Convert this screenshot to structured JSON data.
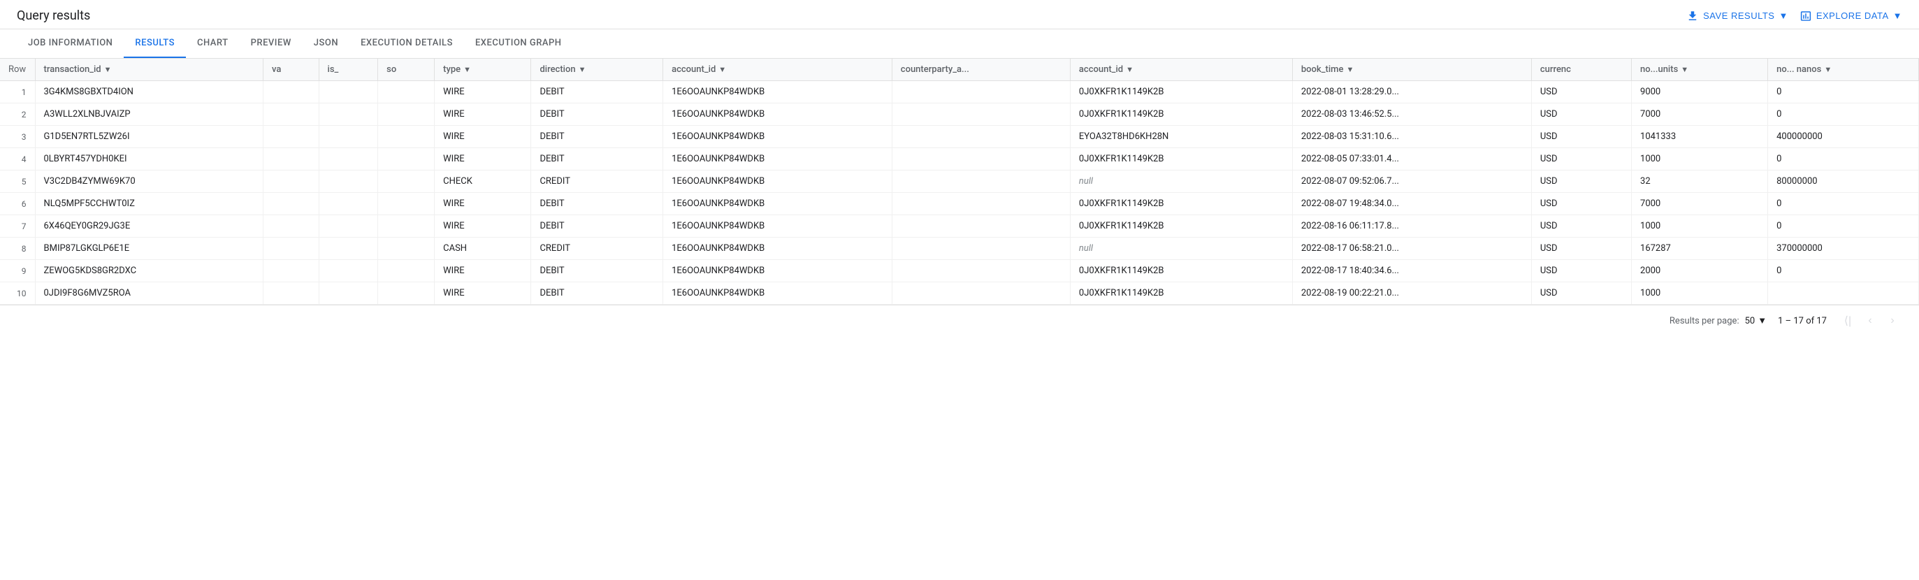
{
  "header": {
    "title": "Query results",
    "save_results_label": "SAVE RESULTS",
    "explore_data_label": "EXPLORE DATA"
  },
  "tabs": [
    {
      "id": "job-information",
      "label": "JOB INFORMATION",
      "active": false
    },
    {
      "id": "results",
      "label": "RESULTS",
      "active": true
    },
    {
      "id": "chart",
      "label": "CHART",
      "active": false
    },
    {
      "id": "preview-badge",
      "label": "PREVIEW",
      "badge": true
    },
    {
      "id": "json",
      "label": "JSON",
      "active": false
    },
    {
      "id": "execution-details",
      "label": "EXECUTION DETAILS",
      "active": false
    },
    {
      "id": "execution-graph",
      "label": "EXECUTION GRAPH",
      "active": false
    }
  ],
  "table": {
    "columns": [
      {
        "id": "row",
        "label": "Row"
      },
      {
        "id": "transaction_id",
        "label": "transaction_id",
        "sortable": true
      },
      {
        "id": "va",
        "label": "va",
        "sortable": false
      },
      {
        "id": "is",
        "label": "is_",
        "sortable": false
      },
      {
        "id": "so",
        "label": "so",
        "sortable": false
      },
      {
        "id": "type",
        "label": "type",
        "sortable": true
      },
      {
        "id": "direction",
        "label": "direction",
        "sortable": true
      },
      {
        "id": "account_id",
        "label": "account_id",
        "sortable": true
      },
      {
        "id": "counterparty_a",
        "label": "counterparty_a...",
        "sortable": false
      },
      {
        "id": "counterparty_account_id",
        "label": "account_id",
        "sortable": true
      },
      {
        "id": "book_time",
        "label": "book_time",
        "sortable": true
      },
      {
        "id": "currency",
        "label": "currenc",
        "sortable": false
      },
      {
        "id": "no_units",
        "label": "no...units",
        "sortable": true
      },
      {
        "id": "no_nanos",
        "label": "no... nanos",
        "sortable": true
      }
    ],
    "rows": [
      {
        "row": 1,
        "transaction_id": "3G4KMS8GBXTD4ION",
        "va": "",
        "is_": "",
        "so": "",
        "type": "WIRE",
        "direction": "DEBIT",
        "account_id": "1E6OOAUNKP84WDKB",
        "counterparty_a": "",
        "counterparty_account_id": "0J0XKFR1K1149K2B",
        "book_time": "2022-08-01 13:28:29.0...",
        "currency": "USD",
        "no_units": "9000",
        "no_nanos": "0"
      },
      {
        "row": 2,
        "transaction_id": "A3WLL2XLNBJVAIZP",
        "va": "",
        "is_": "",
        "so": "",
        "type": "WIRE",
        "direction": "DEBIT",
        "account_id": "1E6OOAUNKP84WDKB",
        "counterparty_a": "",
        "counterparty_account_id": "0J0XKFR1K1149K2B",
        "book_time": "2022-08-03 13:46:52.5...",
        "currency": "USD",
        "no_units": "7000",
        "no_nanos": "0"
      },
      {
        "row": 3,
        "transaction_id": "G1D5EN7RTL5ZW26I",
        "va": "",
        "is_": "",
        "so": "",
        "type": "WIRE",
        "direction": "DEBIT",
        "account_id": "1E6OOAUNKP84WDKB",
        "counterparty_a": "",
        "counterparty_account_id": "EYOA32T8HD6KH28N",
        "book_time": "2022-08-03 15:31:10.6...",
        "currency": "USD",
        "no_units": "1041333",
        "no_nanos": "400000000"
      },
      {
        "row": 4,
        "transaction_id": "0LBYRT457YDH0KEI",
        "va": "",
        "is_": "",
        "so": "",
        "type": "WIRE",
        "direction": "DEBIT",
        "account_id": "1E6OOAUNKP84WDKB",
        "counterparty_a": "",
        "counterparty_account_id": "0J0XKFR1K1149K2B",
        "book_time": "2022-08-05 07:33:01.4...",
        "currency": "USD",
        "no_units": "1000",
        "no_nanos": "0"
      },
      {
        "row": 5,
        "transaction_id": "V3C2DB4ZYMW69K70",
        "va": "",
        "is_": "",
        "so": "",
        "type": "CHECK",
        "direction": "CREDIT",
        "account_id": "1E6OOAUNKP84WDKB",
        "counterparty_a": "",
        "counterparty_account_id": "null",
        "book_time": "2022-08-07 09:52:06.7...",
        "currency": "USD",
        "no_units": "32",
        "no_nanos": "80000000"
      },
      {
        "row": 6,
        "transaction_id": "NLQ5MPF5CCHWT0IZ",
        "va": "",
        "is_": "",
        "so": "",
        "type": "WIRE",
        "direction": "DEBIT",
        "account_id": "1E6OOAUNKP84WDKB",
        "counterparty_a": "",
        "counterparty_account_id": "0J0XKFR1K1149K2B",
        "book_time": "2022-08-07 19:48:34.0...",
        "currency": "USD",
        "no_units": "7000",
        "no_nanos": "0"
      },
      {
        "row": 7,
        "transaction_id": "6X46QEY0GR29JG3E",
        "va": "",
        "is_": "",
        "so": "",
        "type": "WIRE",
        "direction": "DEBIT",
        "account_id": "1E6OOAUNKP84WDKB",
        "counterparty_a": "",
        "counterparty_account_id": "0J0XKFR1K1149K2B",
        "book_time": "2022-08-16 06:11:17.8...",
        "currency": "USD",
        "no_units": "1000",
        "no_nanos": "0"
      },
      {
        "row": 8,
        "transaction_id": "BMIP87LGKGLP6E1E",
        "va": "",
        "is_": "",
        "so": "",
        "type": "CASH",
        "direction": "CREDIT",
        "account_id": "1E6OOAUNKP84WDKB",
        "counterparty_a": "",
        "counterparty_account_id": "null",
        "book_time": "2022-08-17 06:58:21.0...",
        "currency": "USD",
        "no_units": "167287",
        "no_nanos": "370000000"
      },
      {
        "row": 9,
        "transaction_id": "ZEWOG5KDS8GR2DXC",
        "va": "",
        "is_": "",
        "so": "",
        "type": "WIRE",
        "direction": "DEBIT",
        "account_id": "1E6OOAUNKP84WDKB",
        "counterparty_a": "",
        "counterparty_account_id": "0J0XKFR1K1149K2B",
        "book_time": "2022-08-17 18:40:34.6...",
        "currency": "USD",
        "no_units": "2000",
        "no_nanos": "0"
      },
      {
        "row": 10,
        "transaction_id": "0JDI9F8G6MVZ5ROA",
        "va": "",
        "is_": "",
        "so": "",
        "type": "WIRE",
        "direction": "DEBIT",
        "account_id": "1E6OOAUNKP84WDKB",
        "counterparty_a": "",
        "counterparty_account_id": "0J0XKFR1K1149K2B",
        "book_time": "2022-08-19 00:22:21.0...",
        "currency": "USD",
        "no_units": "1000",
        "no_nanos": ""
      }
    ]
  },
  "footer": {
    "results_per_page_label": "Results per page:",
    "per_page_value": "50",
    "range_text": "1 – 17 of 17"
  }
}
